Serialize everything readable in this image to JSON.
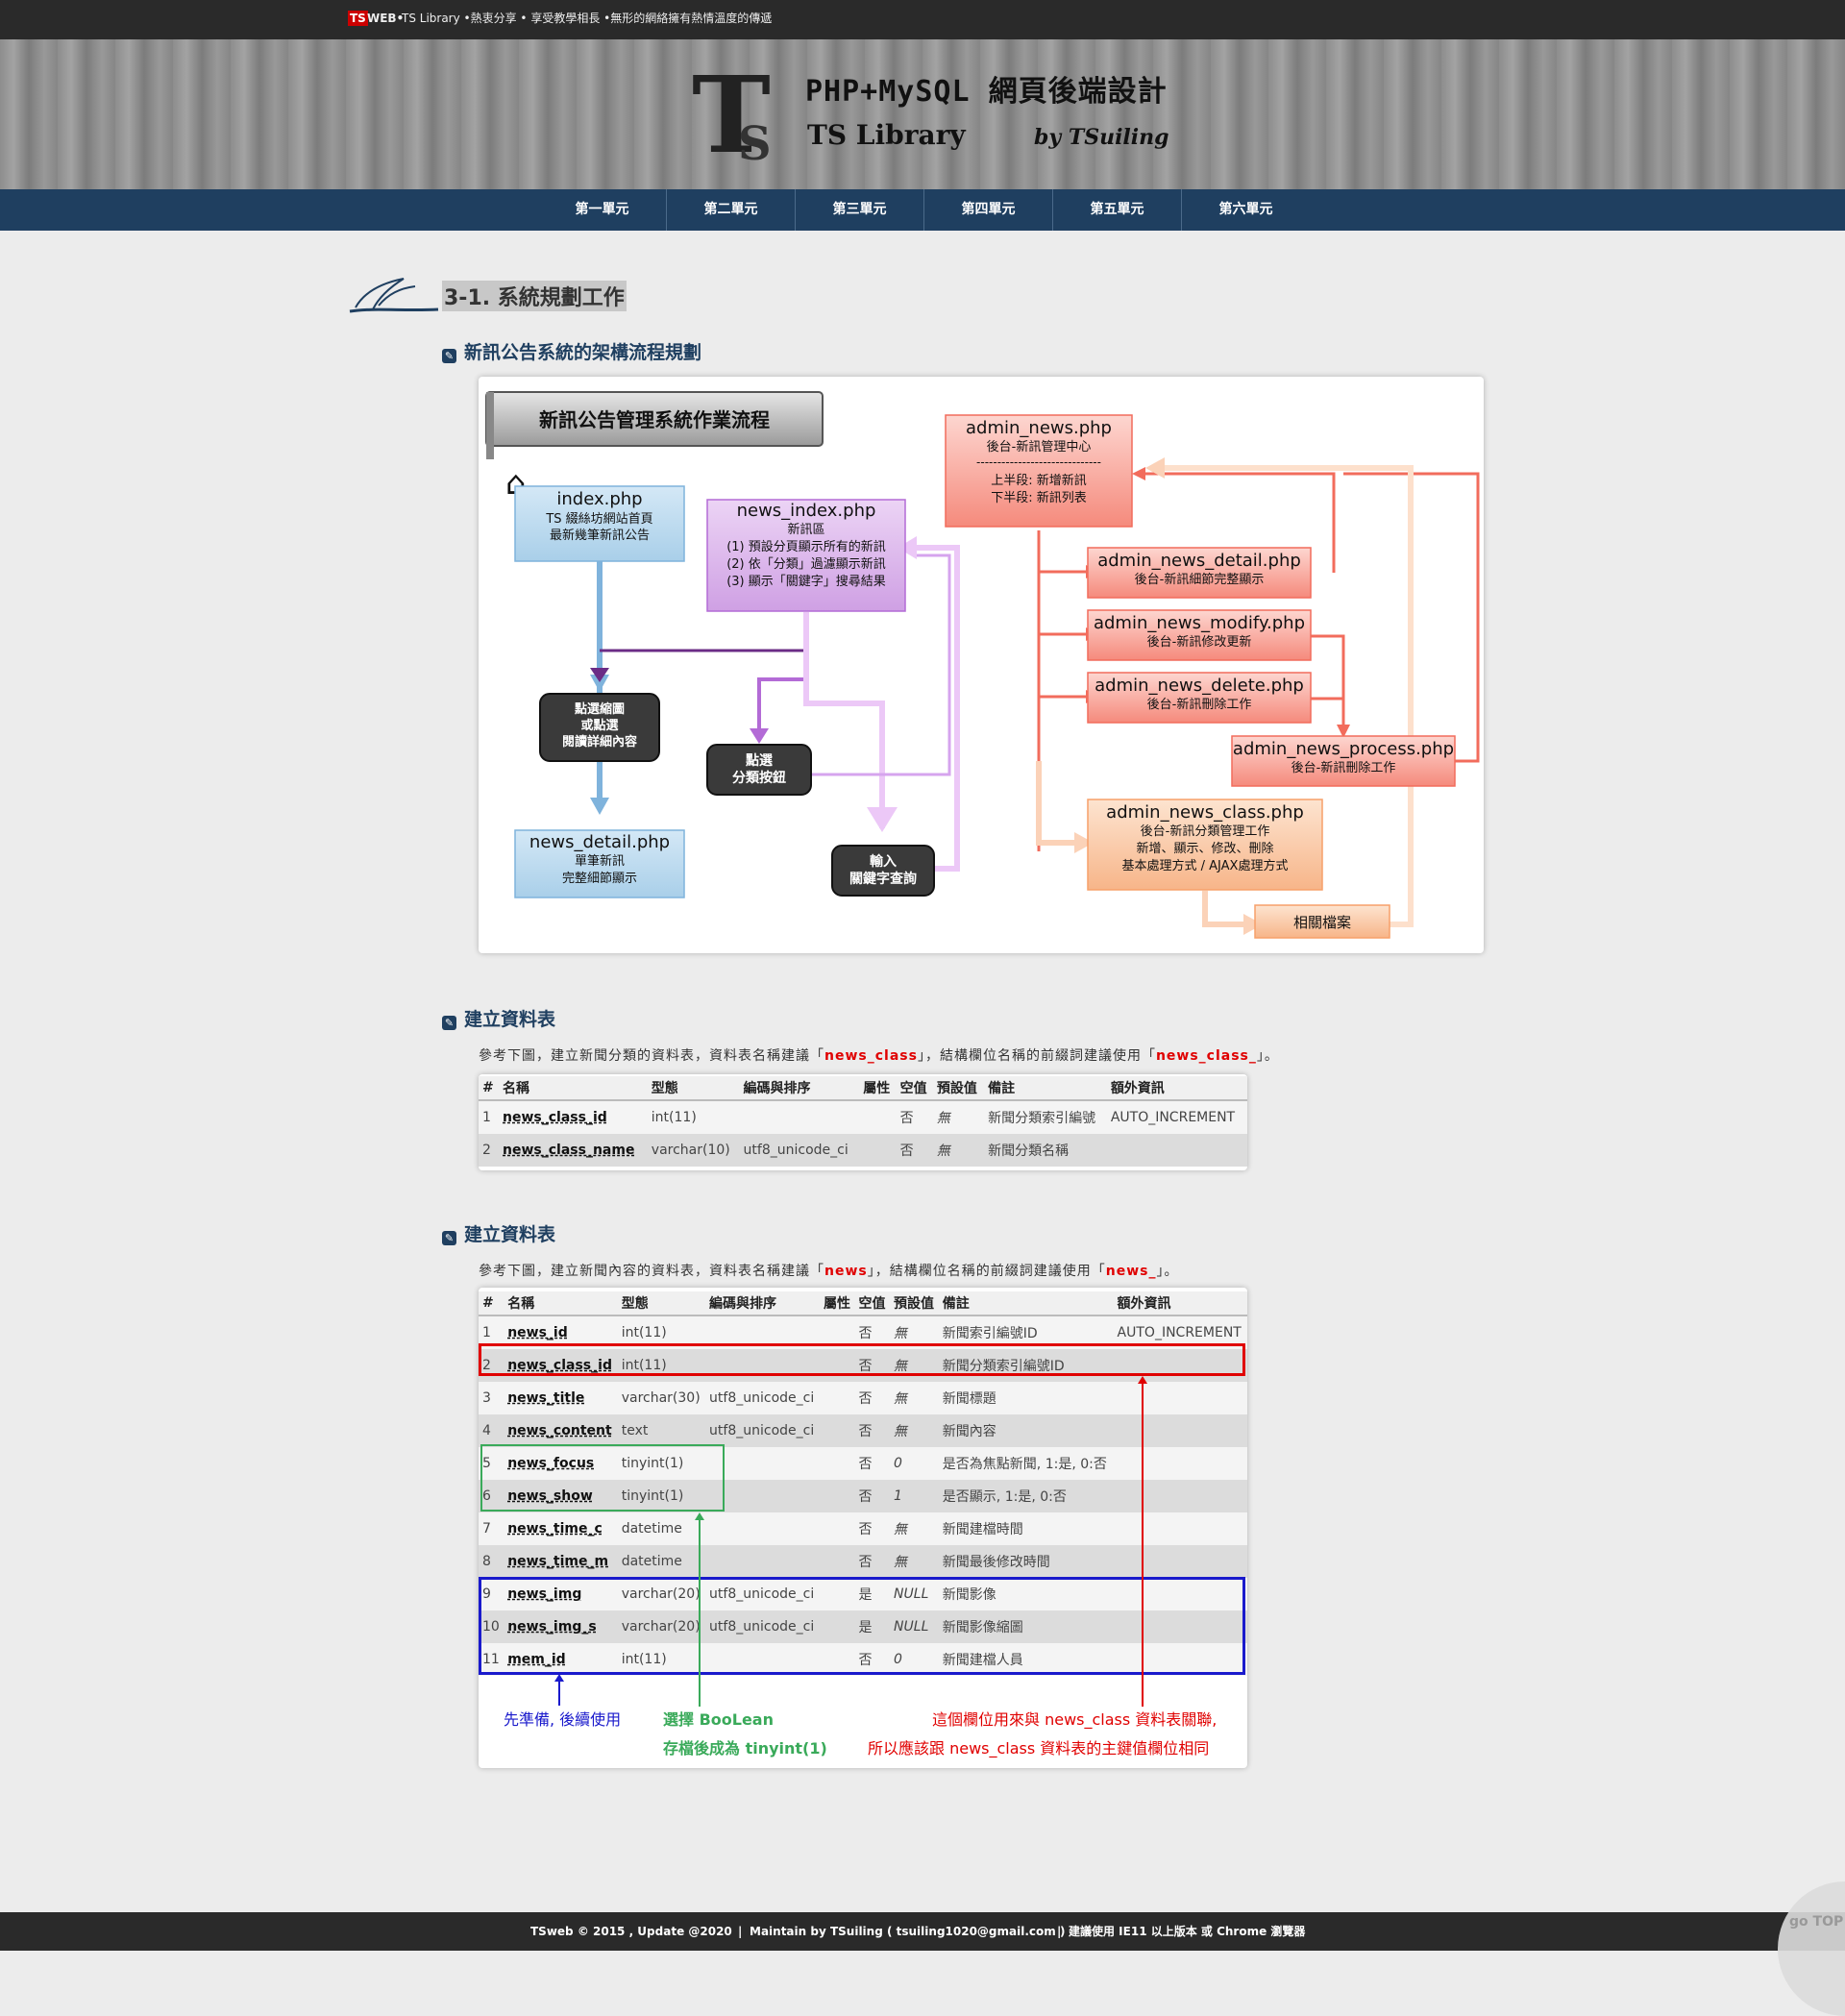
{
  "topbar": {
    "ts": "TS",
    "web": "WEB•",
    "slogan": "TS Library •熱衷分享 • 享受教學相長 •無形的網絡擁有熱情溫度的傳遞"
  },
  "header": {
    "title": "PHP+MySQL 網頁後端設計",
    "library": "TS Library",
    "by": "by TSuiling"
  },
  "nav": [
    "第一單元",
    "第二單元",
    "第三單元",
    "第四單元",
    "第五單元",
    "第六單元"
  ],
  "section": {
    "title": "3-1. 系統規劃工作"
  },
  "sub1": "新訊公告系統的架構流程規劃",
  "diagram": {
    "banner": "新訊公告管理系統作業流程",
    "index": {
      "name": "index.php",
      "l1": "TS 綴絲坊網站首頁",
      "l2": "最新幾筆新訊公告"
    },
    "news_index": {
      "name": "news_index.php",
      "l1": "新訊區",
      "l2": "(1) 預設分頁顯示所有的新訊",
      "l3": "(2) 依「分類」過濾顯示新訊",
      "l4": "(3) 顯示「關鍵字」搜尋結果"
    },
    "click_thumb": {
      "l1": "點選縮圖",
      "l2": "或點選",
      "l3": "閱讀詳細內容"
    },
    "click_class": {
      "l1": "點選",
      "l2": "分類按鈕"
    },
    "input_kw": {
      "l1": "輸入",
      "l2": "關鍵字查詢"
    },
    "news_detail": {
      "name": "news_detail.php",
      "l1": "單筆新訊",
      "l2": "完整細節顯示"
    },
    "admin_news": {
      "name": "admin_news.php",
      "l1": "後台-新訊管理中心",
      "l2": "------------------------------",
      "l3": "上半段: 新增新訊",
      "l4": "下半段: 新訊列表"
    },
    "admin_detail": {
      "name": "admin_news_detail.php",
      "l1": "後台-新訊細節完整顯示"
    },
    "admin_modify": {
      "name": "admin_news_modify.php",
      "l1": "後台-新訊修改更新"
    },
    "admin_delete": {
      "name": "admin_news_delete.php",
      "l1": "後台-新訊刪除工作"
    },
    "admin_process": {
      "name": "admin_news_process.php",
      "l1": "後台-新訊刪除工作"
    },
    "admin_class": {
      "name": "admin_news_class.php",
      "l1": "後台-新訊分類管理工作",
      "l2": "新增、顯示、修改、刪除",
      "l3": "基本處理方式 / AJAX處理方式"
    },
    "related": "相關檔案"
  },
  "sub2": "建立資料表",
  "para2": {
    "pre": "參考下圖，建立新聞分類的資料表，資料表名稱建議「",
    "name": "news_class",
    "mid": "」，結構欄位名稱的前綴詞建議使用「",
    "prefix": "news_class_",
    "post": "」。"
  },
  "table1": {
    "headers": [
      "#",
      "名稱",
      "型態",
      "編碼與排序",
      "屬性",
      "空值",
      "預設值",
      "備註",
      "額外資訊"
    ],
    "rows": [
      [
        "1",
        "news_class_id",
        "int(11)",
        "",
        "",
        "否",
        "無",
        "新聞分類索引編號",
        "AUTO_INCREMENT"
      ],
      [
        "2",
        "news_class_name",
        "varchar(10)",
        "utf8_unicode_ci",
        "",
        "否",
        "無",
        "新聞分類名稱",
        ""
      ]
    ]
  },
  "sub3": "建立資料表",
  "para3": {
    "pre": "參考下圖，建立新聞內容的資料表，資料表名稱建議「",
    "name": "news",
    "mid": "」，結構欄位名稱的前綴詞建議使用「",
    "prefix": "news_",
    "post": "」。"
  },
  "table2": {
    "headers": [
      "#",
      "名稱",
      "型態",
      "編碼與排序",
      "屬性",
      "空值",
      "預設值",
      "備註",
      "額外資訊"
    ],
    "rows": [
      [
        "1",
        "news_id",
        "int(11)",
        "",
        "",
        "否",
        "無",
        "新聞索引編號ID",
        "AUTO_INCREMENT"
      ],
      [
        "2",
        "news_class_id",
        "int(11)",
        "",
        "",
        "否",
        "無",
        "新聞分類索引編號ID",
        ""
      ],
      [
        "3",
        "news_title",
        "varchar(30)",
        "utf8_unicode_ci",
        "",
        "否",
        "無",
        "新聞標題",
        ""
      ],
      [
        "4",
        "news_content",
        "text",
        "utf8_unicode_ci",
        "",
        "否",
        "無",
        "新聞內容",
        ""
      ],
      [
        "5",
        "news_focus",
        "tinyint(1)",
        "",
        "",
        "否",
        "0",
        "是否為焦點新聞, 1:是, 0:否",
        ""
      ],
      [
        "6",
        "news_show",
        "tinyint(1)",
        "",
        "",
        "否",
        "1",
        "是否顯示, 1:是, 0:否",
        ""
      ],
      [
        "7",
        "news_time_c",
        "datetime",
        "",
        "",
        "否",
        "無",
        "新聞建檔時間",
        ""
      ],
      [
        "8",
        "news_time_m",
        "datetime",
        "",
        "",
        "否",
        "無",
        "新聞最後修改時間",
        ""
      ],
      [
        "9",
        "news_img",
        "varchar(20)",
        "utf8_unicode_ci",
        "",
        "是",
        "NULL",
        "新聞影像",
        ""
      ],
      [
        "10",
        "news_img_s",
        "varchar(20)",
        "utf8_unicode_ci",
        "",
        "是",
        "NULL",
        "新聞影像縮圖",
        ""
      ],
      [
        "11",
        "mem_id",
        "int(11)",
        "",
        "",
        "否",
        "0",
        "新聞建檔人員",
        ""
      ]
    ],
    "note_blue": "先準備, 後續使用",
    "note_green1": "選擇 BooLean",
    "note_green2": "存檔後成為 tinyint(1)",
    "note_red1": "這個欄位用來與 news_class 資料表關聯,",
    "note_red2": "所以應該跟 news_class 資料表的主鍵值欄位相同"
  },
  "footer": {
    "copy": "TSweb © 2015 , Update @2020",
    "maintain": "Maintain by TSuiling ( tsuiling1020@gmail.com )",
    "suggest": "建議使用 IE11 以上版本 或 Chrome 瀏覽器"
  },
  "gotop": "go TOP",
  "colors": {
    "nav": "#1f3f60",
    "topbar": "#2a2a2a",
    "red": "#e00000",
    "green": "#3aaa5a",
    "blue": "#1a1acc"
  }
}
